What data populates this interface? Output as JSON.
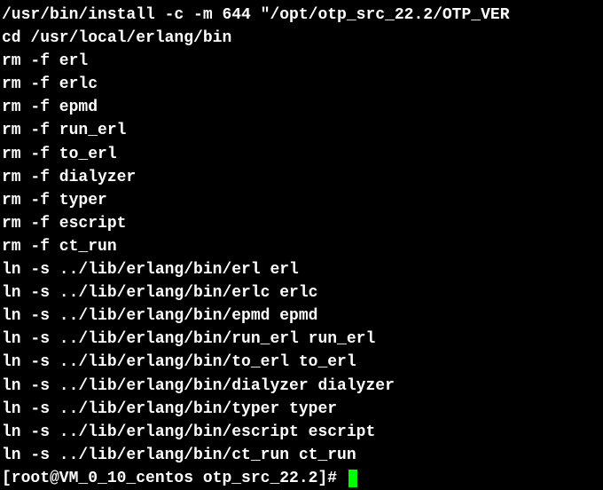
{
  "terminal": {
    "lines": [
      "/usr/bin/install -c -m 644 \"/opt/otp_src_22.2/OTP_VER",
      "cd /usr/local/erlang/bin",
      "rm -f erl",
      "rm -f erlc",
      "rm -f epmd",
      "rm -f run_erl",
      "rm -f to_erl",
      "rm -f dialyzer",
      "rm -f typer",
      "rm -f escript",
      "rm -f ct_run",
      "ln -s ../lib/erlang/bin/erl erl",
      "ln -s ../lib/erlang/bin/erlc erlc",
      "ln -s ../lib/erlang/bin/epmd epmd",
      "ln -s ../lib/erlang/bin/run_erl run_erl",
      "ln -s ../lib/erlang/bin/to_erl to_erl",
      "ln -s ../lib/erlang/bin/dialyzer dialyzer",
      "ln -s ../lib/erlang/bin/typer typer",
      "ln -s ../lib/erlang/bin/escript escript",
      "ln -s ../lib/erlang/bin/ct_run ct_run"
    ],
    "prompt": "[root@VM_0_10_centos otp_src_22.2]# "
  }
}
